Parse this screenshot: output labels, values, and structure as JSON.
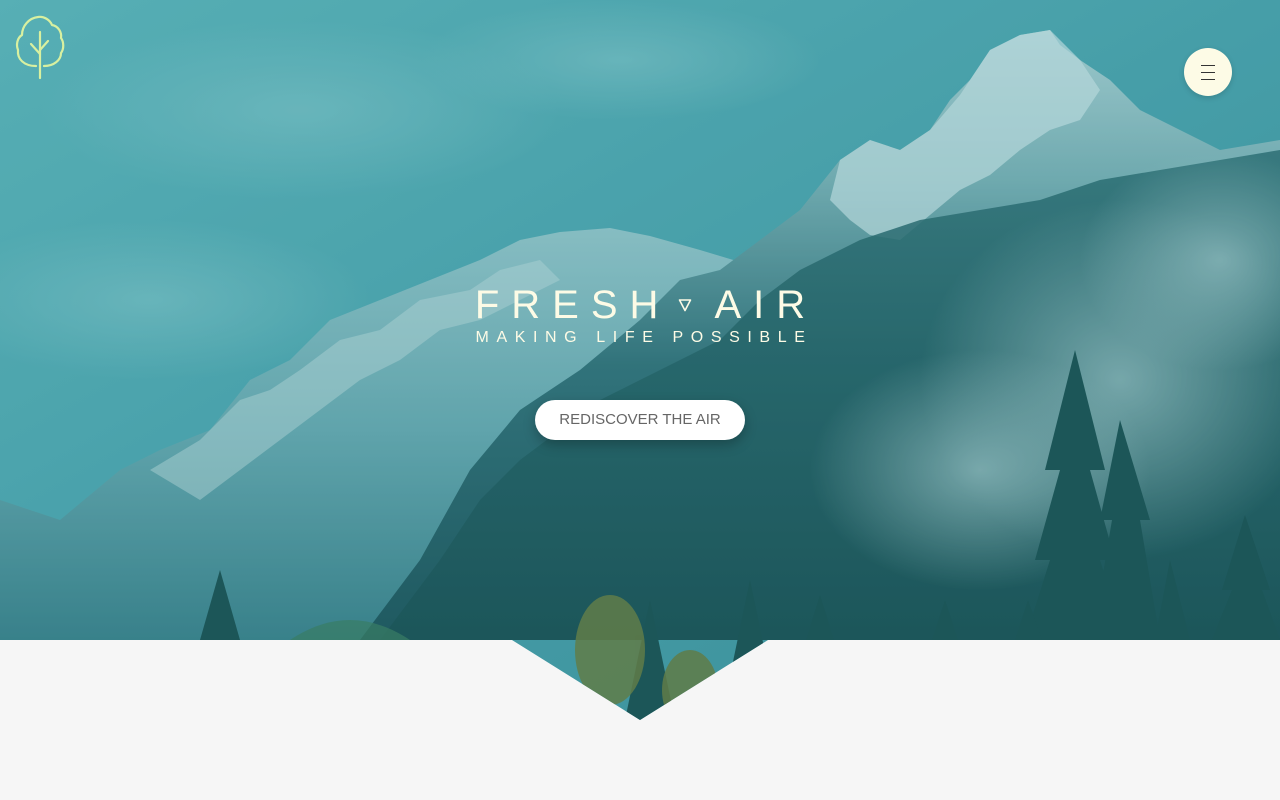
{
  "header": {
    "logo_icon": "tree-icon",
    "menu_icon": "hamburger-icon"
  },
  "hero": {
    "title_left": "FRESH",
    "title_right": "AIR",
    "separator_icon": "triangle-down-icon",
    "tagline": "MAKING LIFE POSSIBLE",
    "cta_label": "REDISCOVER THE AIR"
  },
  "colors": {
    "overlay": "#2a8f9a",
    "logo": "#d8f0a0",
    "menu_bg": "#fdfbe6",
    "text_light": "#fdfbe6",
    "page_bg": "#f6f6f6"
  }
}
